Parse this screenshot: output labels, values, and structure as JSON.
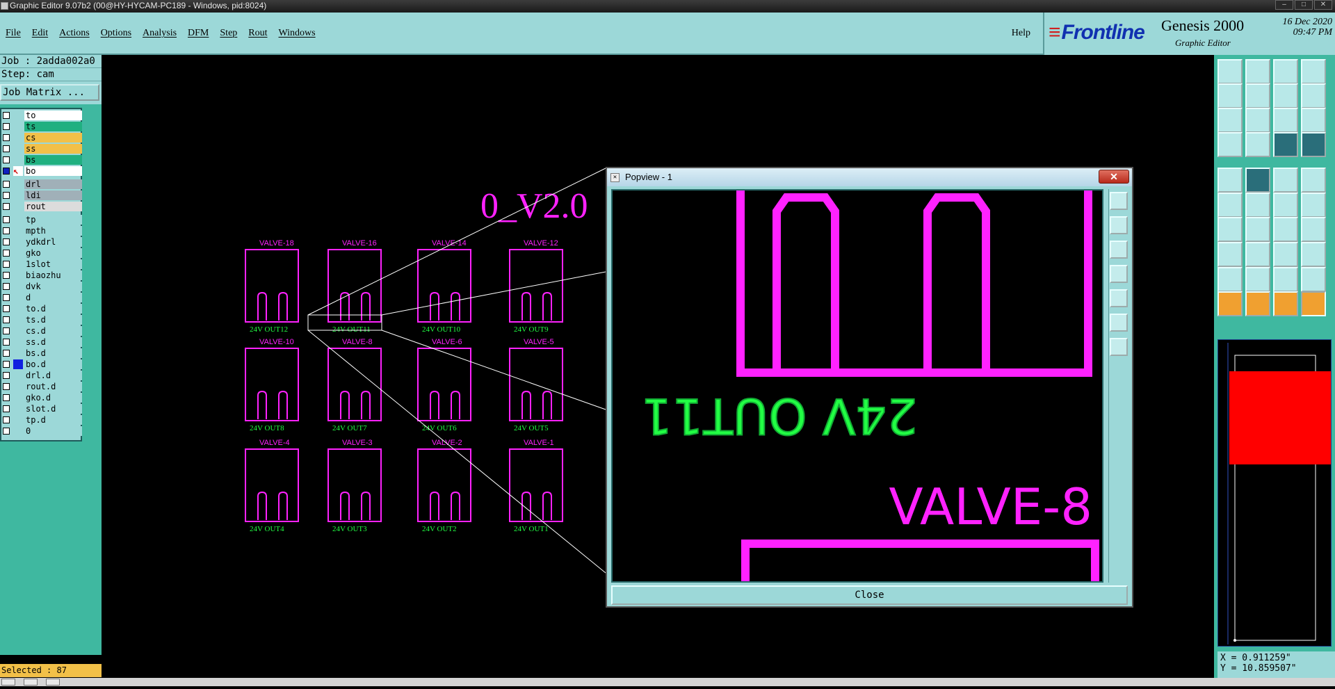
{
  "window": {
    "title": "Graphic Editor 9.07b2 (00@HY-HYCAM-PC189 - Windows, pid:8024)"
  },
  "menu": {
    "items": [
      "File",
      "Edit",
      "Actions",
      "Options",
      "Analysis",
      "DFM",
      "Step",
      "Rout",
      "Windows"
    ],
    "help": "Help"
  },
  "brand": {
    "logo": "Frontline",
    "product": "Genesis 2000",
    "subtitle": "Graphic Editor",
    "date": "16 Dec 2020",
    "time": "09:47 PM"
  },
  "job": {
    "job_label": "Job : 2adda002a0",
    "step_label": "Step: cam",
    "matrix_button": "Job Matrix ..."
  },
  "layers": [
    {
      "name": "to",
      "color": "#ffffff",
      "flag": "◆"
    },
    {
      "name": "ts",
      "color": "#20b080",
      "flag": ""
    },
    {
      "name": "cs",
      "color": "#f2c048",
      "flag": ""
    },
    {
      "name": "ss",
      "color": "#f2c048",
      "flag": ""
    },
    {
      "name": "bs",
      "color": "#20b080",
      "flag": ""
    },
    {
      "name": "bo",
      "color": "#ffffff",
      "flag": "■",
      "work": true
    },
    {
      "name": "drl",
      "color": "#a0b0b8",
      "flag": ""
    },
    {
      "name": "ldi",
      "color": "#a0b0b8",
      "flag": ""
    },
    {
      "name": "rout",
      "color": "#dcdcdc",
      "flag": ""
    },
    {
      "name": "tp",
      "color": "#9cd8d8",
      "flag": ""
    },
    {
      "name": "mpth",
      "color": "#9cd8d8",
      "flag": ""
    },
    {
      "name": "ydkdrl",
      "color": "#9cd8d8",
      "flag": ""
    },
    {
      "name": "gko",
      "color": "#9cd8d8",
      "flag": "◆"
    },
    {
      "name": "1slot",
      "color": "#9cd8d8",
      "flag": ""
    },
    {
      "name": "biaozhu",
      "color": "#9cd8d8",
      "flag": ""
    },
    {
      "name": "dvk",
      "color": "#9cd8d8",
      "flag": ""
    },
    {
      "name": "d",
      "color": "#9cd8d8",
      "flag": ""
    },
    {
      "name": "to.d",
      "color": "#9cd8d8",
      "flag": "◆"
    },
    {
      "name": "ts.d",
      "color": "#9cd8d8",
      "flag": ""
    },
    {
      "name": "cs.d",
      "color": "#9cd8d8",
      "flag": ""
    },
    {
      "name": "ss.d",
      "color": "#9cd8d8",
      "flag": ""
    },
    {
      "name": "bs.d",
      "color": "#9cd8d8",
      "flag": ""
    },
    {
      "name": "bo.d",
      "color": "#9cd8d8",
      "flag": "",
      "marker": true
    },
    {
      "name": "drl.d",
      "color": "#9cd8d8",
      "flag": ""
    },
    {
      "name": "rout.d",
      "color": "#9cd8d8",
      "flag": ""
    },
    {
      "name": "gko.d",
      "color": "#9cd8d8",
      "flag": "◆"
    },
    {
      "name": "slot.d",
      "color": "#9cd8d8",
      "flag": ""
    },
    {
      "name": "tp.d",
      "color": "#9cd8d8",
      "flag": ""
    },
    {
      "name": "0",
      "color": "#9cd8d8",
      "flag": ""
    }
  ],
  "canvas": {
    "board_text": "0_V2.0",
    "components": [
      {
        "valve": "VALVE-18",
        "out": "24V OUT12"
      },
      {
        "valve": "VALVE-16",
        "out": "24V OUT11"
      },
      {
        "valve": "VALVE-14",
        "out": "24V OUT10"
      },
      {
        "valve": "VALVE-12",
        "out": "24V OUT9"
      },
      {
        "valve": "VALVE-10",
        "out": "24V OUT8"
      },
      {
        "valve": "VALVE-8",
        "out": "24V OUT7"
      },
      {
        "valve": "VALVE-6",
        "out": "24V OUT6"
      },
      {
        "valve": "VALVE-5",
        "out": "24V OUT5"
      },
      {
        "valve": "VALVE-4",
        "out": "24V OUT4"
      },
      {
        "valve": "VALVE-3",
        "out": "24V OUT3"
      },
      {
        "valve": "VALVE-2",
        "out": "24V OUT2"
      },
      {
        "valve": "VALVE-1",
        "out": "24V OUT1"
      }
    ],
    "colors": {
      "copper": "#ff22ff",
      "silk": "#22ff44",
      "zoom_line": "#ffffff"
    }
  },
  "popview": {
    "title": "Popview - 1",
    "close_x": "✕",
    "close_button": "Close",
    "zoom_out_text": "24V OUT11",
    "zoom_valve_text": "VALVE-8"
  },
  "selected": "Selected : 87",
  "coords": {
    "x": "X = 0.911259\"",
    "y": "Y = 10.859507\""
  }
}
